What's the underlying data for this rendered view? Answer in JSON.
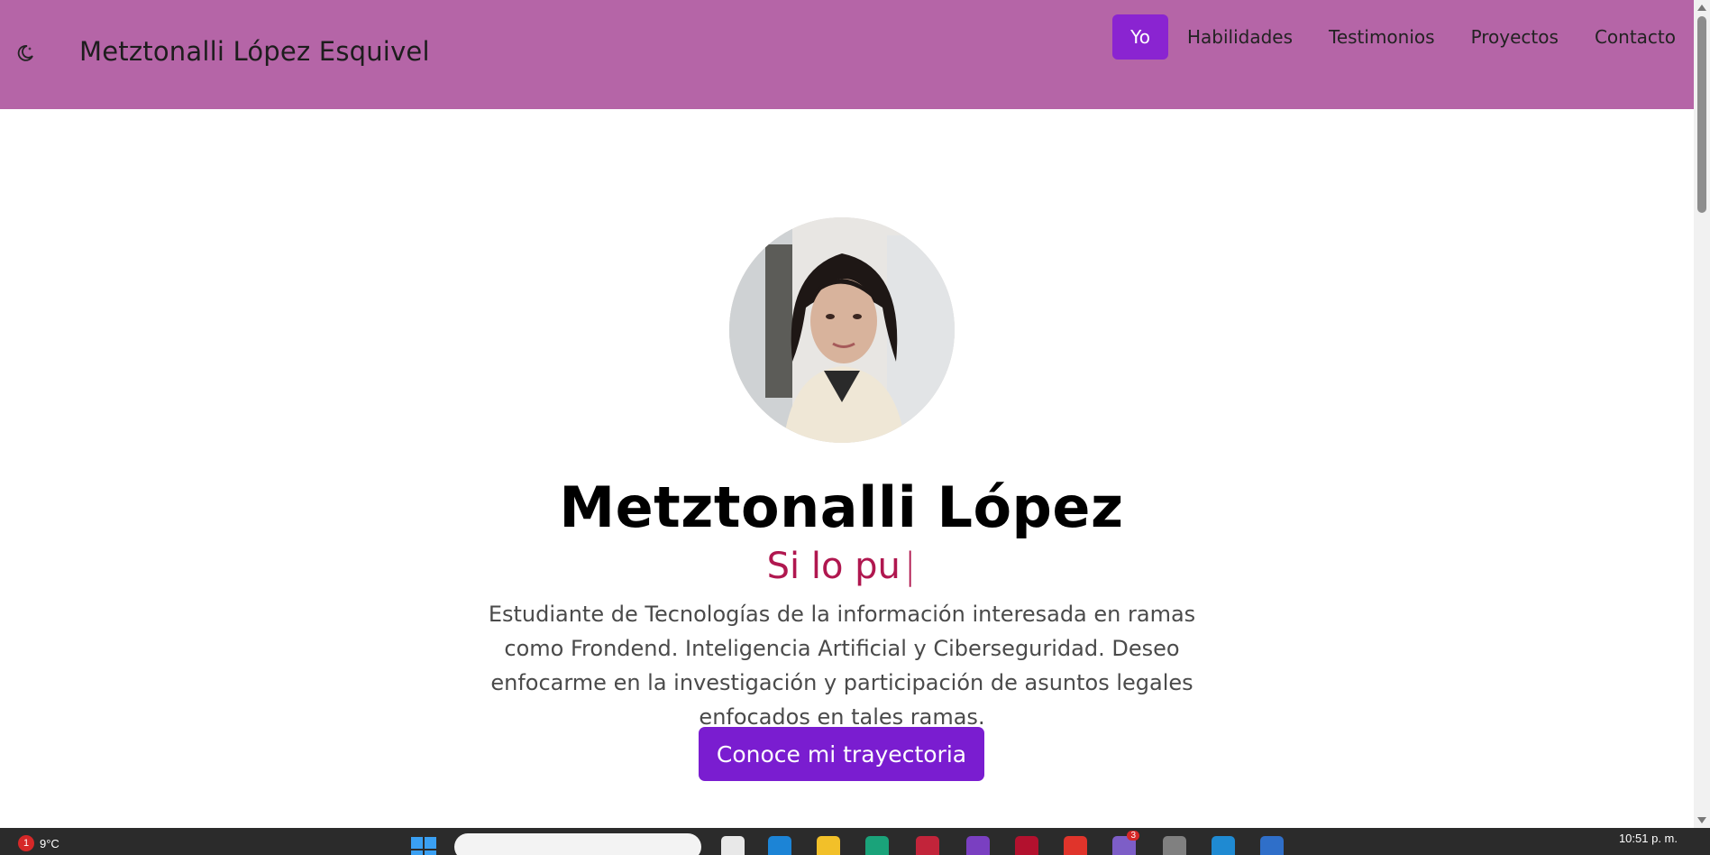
{
  "header": {
    "brand": "Metztonalli López Esquivel",
    "nav": [
      {
        "label": "Yo",
        "active": true
      },
      {
        "label": "Habilidades",
        "active": false
      },
      {
        "label": "Testimonios",
        "active": false
      },
      {
        "label": "Proyectos",
        "active": false
      },
      {
        "label": "Contacto",
        "active": false
      }
    ],
    "theme_toggle_icon": "moon-icon"
  },
  "hero": {
    "name": "Metztonalli López",
    "typed_text": "Si lo pu",
    "typed_cursor": "|",
    "bio": "Estudiante de Tecnologías de la información interesada en ramas como Frondend. Inteligencia Artificial y Ciberseguridad. Deseo enfocarme en la investigación y participación de asuntos legales enfocados en tales ramas.",
    "cta_label": "Conoce mi trayectoria",
    "avatar_icon": "profile-photo"
  },
  "taskbar": {
    "weather_badge": "1",
    "weather_temp": "9°C",
    "clock": "10:51 p. m.",
    "app_badge": "3"
  },
  "colors": {
    "header_bg": "#b565a7",
    "accent": "#8a24d1",
    "typed_color": "#b0174f"
  }
}
